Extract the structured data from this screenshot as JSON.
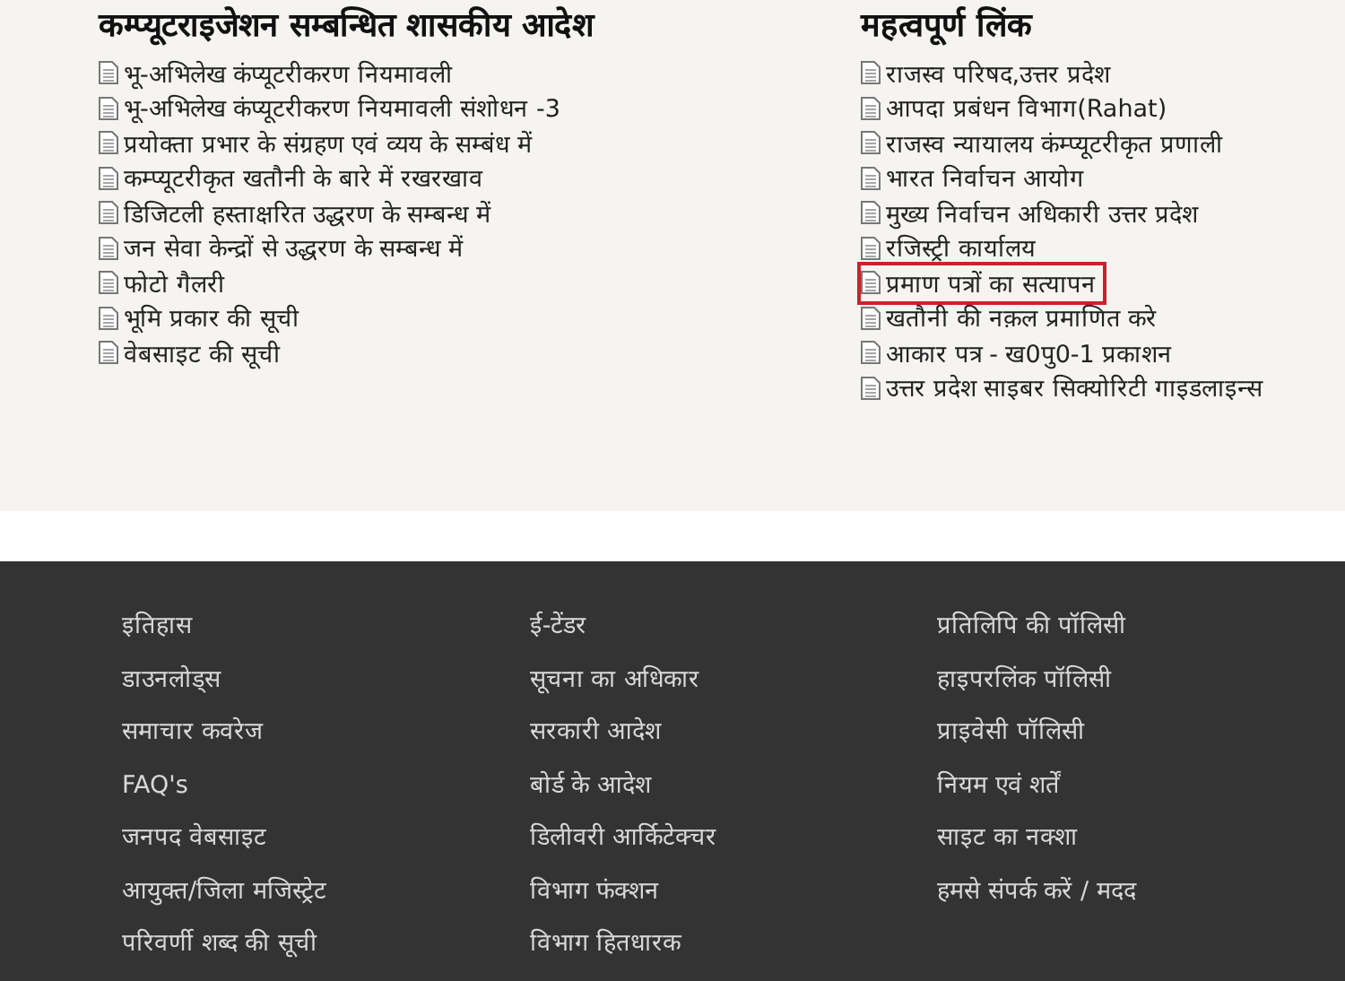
{
  "sections": [
    {
      "title": "कम्प्यूटराइजेशन सम्बन्धित शासकीय आदेश",
      "items": [
        {
          "label": "भू-अभिलेख कंप्यूटरीकरण नियमावली",
          "highlighted": false
        },
        {
          "label": "भू-अभिलेख कंप्यूटरीकरण नियमावली संशोधन -3",
          "highlighted": false
        },
        {
          "label": "प्रयोक्ता प्रभार के संग्रहण एवं व्यय के सम्बंध में",
          "highlighted": false
        },
        {
          "label": "कम्प्यूटरीकृत खतौनी के बारे में रखरखाव",
          "highlighted": false
        },
        {
          "label": "डिजिटली हस्ताक्षरित उद्धरण के सम्बन्ध में",
          "highlighted": false
        },
        {
          "label": "जन सेवा केन्द्रों से उद्धरण के सम्बन्ध में",
          "highlighted": false
        },
        {
          "label": "फोटो गैलरी",
          "highlighted": false
        },
        {
          "label": "भूमि प्रकार की सूची",
          "highlighted": false
        },
        {
          "label": "वेबसाइट की सूची",
          "highlighted": false
        }
      ]
    },
    {
      "title": "महत्वपूर्ण लिंक",
      "items": [
        {
          "label": "राजस्व परिषद,उत्तर प्रदेश",
          "highlighted": false
        },
        {
          "label": "आपदा प्रबंधन विभाग(Rahat)",
          "highlighted": false
        },
        {
          "label": "राजस्व न्यायालय कंम्प्यूटरीकृत प्रणाली",
          "highlighted": false
        },
        {
          "label": "भारत निर्वाचन आयोग",
          "highlighted": false
        },
        {
          "label": "मुख्य निर्वाचन अधिकारी उत्तर प्रदेश",
          "highlighted": false
        },
        {
          "label": "रजिस्ट्री कार्यालय",
          "highlighted": false
        },
        {
          "label": "प्रमाण पत्रों का सत्यापन",
          "highlighted": true
        },
        {
          "label": "खतौनी की नक़ल प्रमाणित करे",
          "highlighted": false
        },
        {
          "label": "आकार पत्र - ख0पु0-1 प्रकाशन",
          "highlighted": false
        },
        {
          "label": "उत्तर प्रदेश साइबर सिक्योरिटी गाइडलाइन्स",
          "highlighted": false
        }
      ]
    }
  ],
  "footer": {
    "columns": [
      [
        "इतिहास",
        "डाउनलोड्स",
        "समाचार कवरेज",
        "FAQ's",
        "जनपद वेबसाइट",
        "आयुक्त/जिला मजिस्ट्रेट",
        "परिवर्णी शब्द की सूची"
      ],
      [
        "ई-टेंडर",
        "सूचना का अधिकार",
        "सरकारी आदेश",
        "बोर्ड के आदेश",
        "डिलीवरी आर्किटेक्चर",
        "विभाग फंक्शन",
        "विभाग हितधारक"
      ],
      [
        "प्रतिलिपि की पॉलिसी",
        "हाइपरलिंक पॉलिसी",
        "प्राइवेसी पॉलिसी",
        "नियम एवं शर्तें",
        "साइट का नक्शा",
        "हमसे संपर्क करें / मदद"
      ]
    ]
  }
}
